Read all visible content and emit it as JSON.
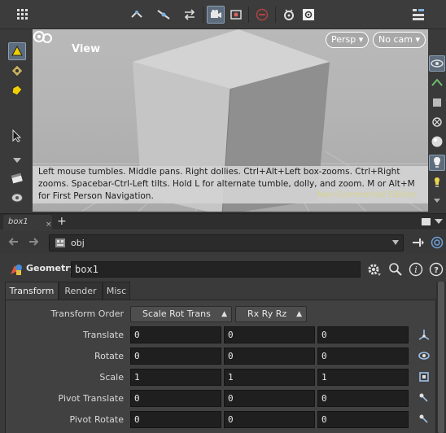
{
  "toolbar": {
    "items": [
      {
        "name": "grid-menu-icon",
        "glyph": "⠿"
      },
      {
        "name": "snap-pivot-icon",
        "glyph": "✥"
      },
      {
        "name": "snap-point-icon",
        "glyph": "✦"
      },
      {
        "name": "snap-curve-icon",
        "glyph": "⇄"
      },
      {
        "name": "camera-view-icon",
        "glyph": "🎥"
      },
      {
        "name": "record-icon",
        "glyph": "⏺"
      },
      {
        "name": "stop-icon",
        "glyph": "⊖"
      },
      {
        "name": "display-options-icon",
        "glyph": "⚙"
      },
      {
        "name": "settings-icon",
        "glyph": "✲"
      },
      {
        "name": "view-layout-icon",
        "glyph": "☰"
      }
    ]
  },
  "viewport": {
    "title": "View",
    "persp_label": "Persp ▾",
    "cam_label": "No cam ▾",
    "help_text": "Left mouse tumbles. Middle pans. Right dollies. Ctrl+Alt+Left box-zooms. Ctrl+Right zooms. Spacebar-Ctrl-Left tilts. Hold L for alternate tumble, dolly, and zoom. M or Alt+M for First Person Navigation.",
    "watermark": "Non-Commercial Edition"
  },
  "pane_tab": {
    "label": "box1",
    "close": "×",
    "add": "+"
  },
  "path": {
    "value": "obj"
  },
  "node": {
    "type_label": "Geometry",
    "name": "box1"
  },
  "param_tabs": [
    {
      "label": "Transform",
      "active": true
    },
    {
      "label": "Render",
      "active": false
    },
    {
      "label": "Misc",
      "active": false
    }
  ],
  "transform": {
    "order_label": "Transform Order",
    "order_value": "Scale Rot Trans",
    "rot_order_value": "Rx Ry Rz",
    "rows": [
      {
        "label": "Translate",
        "x": "0",
        "y": "0",
        "z": "0"
      },
      {
        "label": "Rotate",
        "x": "0",
        "y": "0",
        "z": "0"
      },
      {
        "label": "Scale",
        "x": "1",
        "y": "1",
        "z": "1"
      },
      {
        "label": "Pivot Translate",
        "x": "0",
        "y": "0",
        "z": "0"
      },
      {
        "label": "Pivot Rotate",
        "x": "0",
        "y": "0",
        "z": "0"
      }
    ]
  },
  "colors": {
    "accent_active": "#5e6d7d",
    "viewport_bg": "#b4b4b4",
    "field_bg": "#1f1f1f",
    "watermark": "#d8d28a"
  }
}
